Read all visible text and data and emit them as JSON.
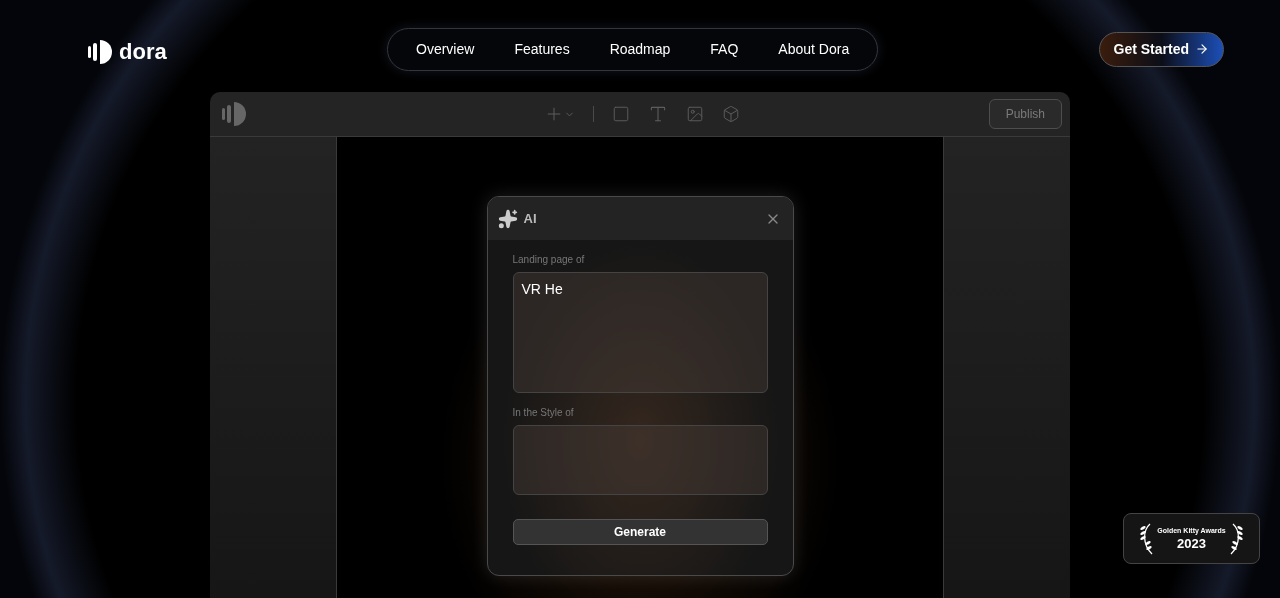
{
  "brand": {
    "name": "dora"
  },
  "nav": {
    "links": [
      "Overview",
      "Features",
      "Roadmap",
      "FAQ",
      "About Dora"
    ]
  },
  "cta": {
    "label": "Get Started"
  },
  "editor": {
    "publish_button": "Publish",
    "dialog": {
      "title": "AI",
      "fields": [
        {
          "label": "Landing page of",
          "value": "VR He"
        },
        {
          "label": "In the Style of"
        }
      ],
      "button": "Generate"
    }
  },
  "award": {
    "title": "Golden Kitty Awards",
    "year": "2023"
  }
}
